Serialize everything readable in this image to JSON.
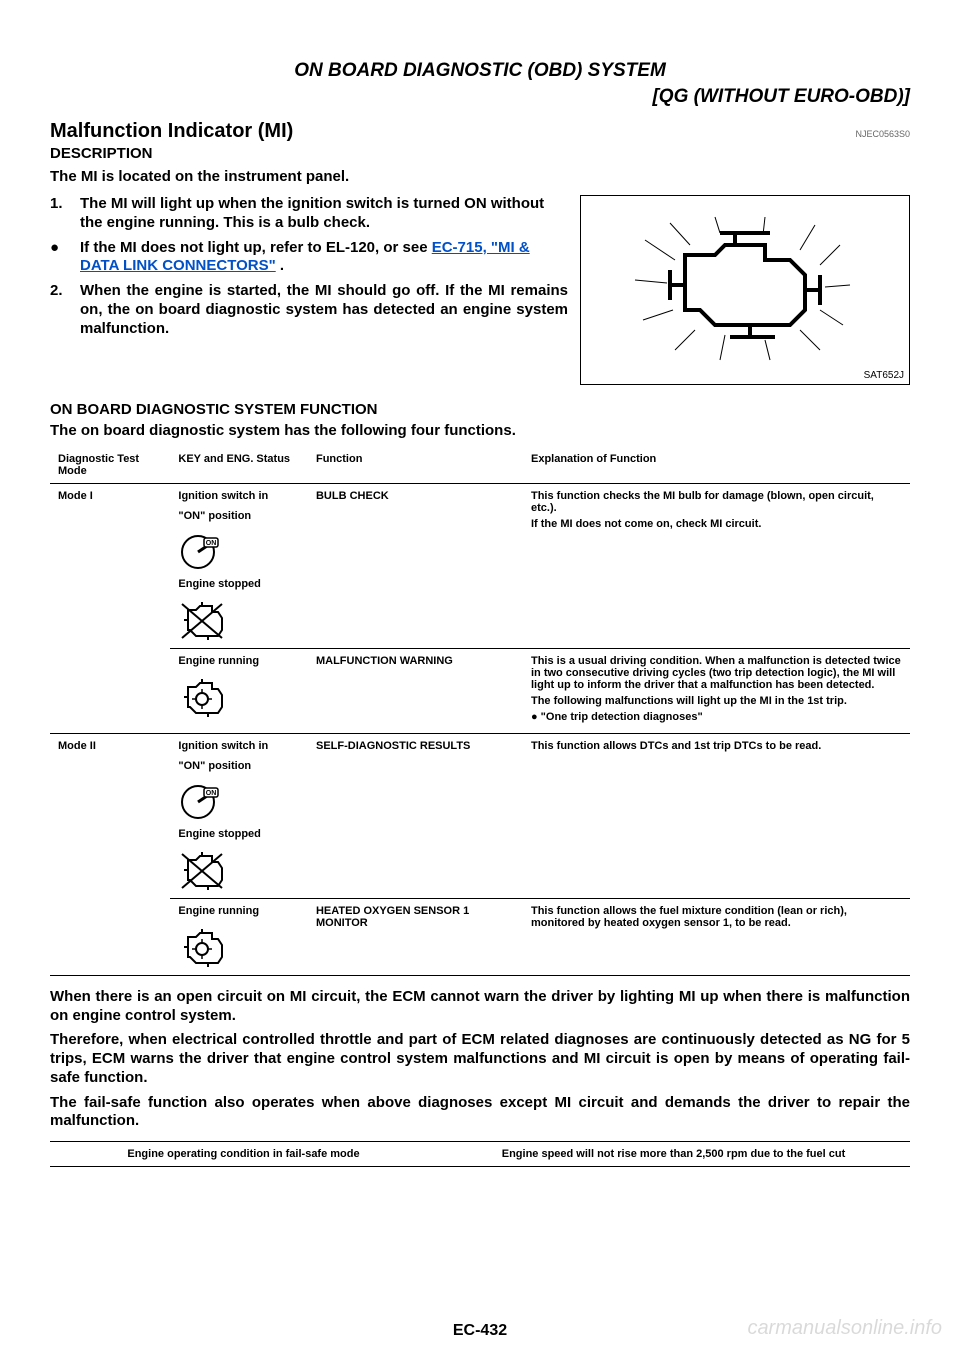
{
  "header": {
    "line1": "ON BOARD DIAGNOSTIC (OBD) SYSTEM",
    "line2": "[QG (WITHOUT EURO-OBD)]"
  },
  "mi_section": {
    "title": "Malfunction Indicator (MI)",
    "code": "NJEC0563S0",
    "description_label": "DESCRIPTION",
    "intro": "The MI is located on the instrument panel.",
    "step1_num": "1.",
    "step1_text": "The MI will light up when the ignition switch is turned ON without the engine running. This is a bulb check.",
    "bullet_dot": "●",
    "bullet_text_before": "If the MI does not light up, refer to EL-120, or see ",
    "bullet_link": "EC-715, \"MI & DATA LINK CONNECTORS\"",
    "bullet_after": " .",
    "step2_num": "2.",
    "step2_text": "When the engine is started, the MI should go off.\nIf the MI remains on, the on board diagnostic system has detected an engine system malfunction.",
    "figure_label": "SAT652J"
  },
  "obd_function": {
    "title": "ON BOARD DIAGNOSTIC SYSTEM FUNCTION",
    "intro": "The on board diagnostic system has the following four functions."
  },
  "table": {
    "headers": [
      "Diagnostic Test Mode",
      "KEY and ENG. Status",
      "Function",
      "Explanation of Function"
    ],
    "mode1_label": "Mode I",
    "mode1_key1_line1": "Ignition switch in",
    "mode1_key1_line2": "\"ON\" position",
    "mode1_key1_line3": "Engine stopped",
    "mode1_func1": "BULB CHECK",
    "mode1_exp1_line1": "This function checks the MI bulb for damage (blown, open circuit, etc.).",
    "mode1_exp1_line2": "If the MI does not come on, check MI circuit.",
    "mode1_key2": "Engine running",
    "mode1_func2": "MALFUNCTION WARNING",
    "mode1_exp2_line1": "This is a usual driving condition. When a malfunction is detected twice in two consecutive driving cycles (two trip detection logic), the MI will light up to inform the driver that a malfunction has been detected.",
    "mode1_exp2_line2": "The following malfunctions will light up the MI in the 1st trip.",
    "mode1_exp2_bullet": "● \"One trip detection diagnoses\"",
    "mode2_label": "Mode II",
    "mode2_key1_line1": "Ignition switch in",
    "mode2_key1_line2": "\"ON\" position",
    "mode2_key1_line3": "Engine stopped",
    "mode2_func1": "SELF-DIAGNOSTIC RESULTS",
    "mode2_exp1": "This function allows DTCs and 1st trip DTCs to be read.",
    "mode2_key2": "Engine running",
    "mode2_func2": "HEATED OXYGEN SENSOR 1 MONITOR",
    "mode2_exp2": "This function allows the fuel mixture condition (lean or rich), monitored by heated oxygen sensor 1, to be read."
  },
  "notes": {
    "para1": "When there is an open circuit on MI circuit, the ECM cannot warn the driver by lighting MI up when there is malfunction on engine control system.",
    "para2": "Therefore, when electrical controlled throttle and part of ECM related diagnoses are continuously detected as NG for 5 trips, ECM warns the driver that engine control system malfunctions and MI circuit is open by means of operating fail-safe function.",
    "para3": "The fail-safe function also operates when above diagnoses except MI circuit and demands the driver to repair the malfunction."
  },
  "failsafe_table": {
    "left": "Engine operating condition in fail-safe mode",
    "right": "Engine speed will not rise more than 2,500 rpm due to the fuel cut"
  },
  "page_num": "EC-432",
  "watermark": "carmanualsonline.info"
}
